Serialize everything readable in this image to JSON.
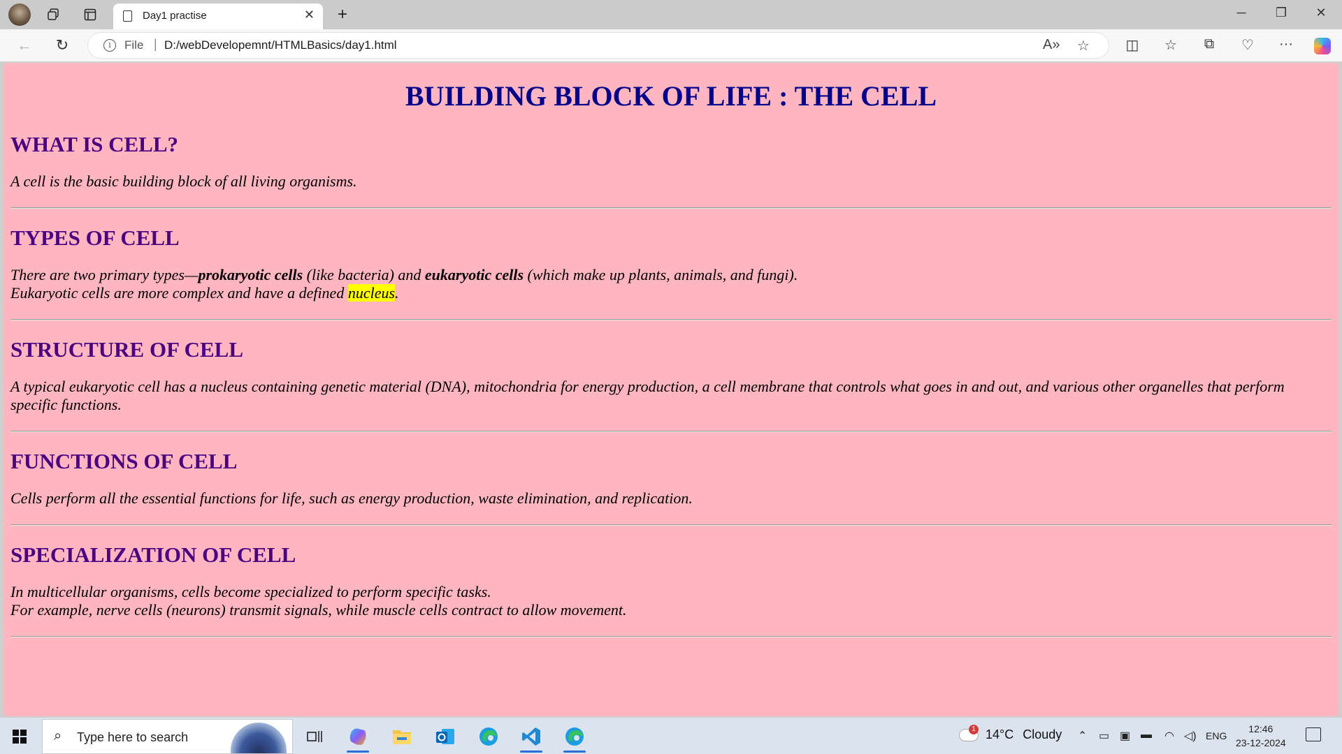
{
  "browser": {
    "tab_title": "Day1 practise",
    "url_scheme_label": "File",
    "url": "D:/webDevelopemnt/HTMLBasics/day1.html"
  },
  "page": {
    "title": "BUILDING BLOCK OF LIFE : THE CELL",
    "sections": [
      {
        "heading": "WHAT IS CELL?",
        "text": "A cell is the basic building block of all living organisms."
      },
      {
        "heading": "TYPES OF CELL",
        "line1_a": "There are two primary types—",
        "line1_b": "prokaryotic cells",
        "line1_c": " (like bacteria) and ",
        "line1_d": "eukaryotic cells",
        "line1_e": " (which make up plants, animals, and fungi).",
        "line2_a": "Eukaryotic cells are more complex and have a defined ",
        "line2_hl": "nucleus",
        "line2_end": "."
      },
      {
        "heading": "STRUCTURE OF CELL",
        "text": "A typical eukaryotic cell has a nucleus containing genetic material (DNA), mitochondria for energy production, a cell membrane that controls what goes in and out, and various other organelles that perform specific functions."
      },
      {
        "heading": "FUNCTIONS OF CELL",
        "text": "Cells perform all the essential functions for life, such as energy production, waste elimination, and replication."
      },
      {
        "heading": "SPECIALIZATION OF CELL",
        "line1": "In multicellular organisms, cells become specialized to perform specific tasks.",
        "line2": "For example, nerve cells (neurons) transmit signals, while muscle cells contract to allow movement."
      }
    ],
    "colors": {
      "background": "#ffb6c1",
      "title": "#00008b",
      "heading": "#4b0082",
      "highlight": "#ffff00"
    }
  },
  "taskbar": {
    "search_placeholder": "Type here to search",
    "weather_temp": "14°C",
    "weather_desc": "Cloudy",
    "weather_alert_count": "1",
    "language": "ENG",
    "time": "12:46",
    "date": "23-12-2024",
    "pinned": [
      "copilot-icon",
      "file-explorer-icon",
      "outlook-icon",
      "edge-icon",
      "vscode-icon",
      "edge-icon"
    ]
  }
}
